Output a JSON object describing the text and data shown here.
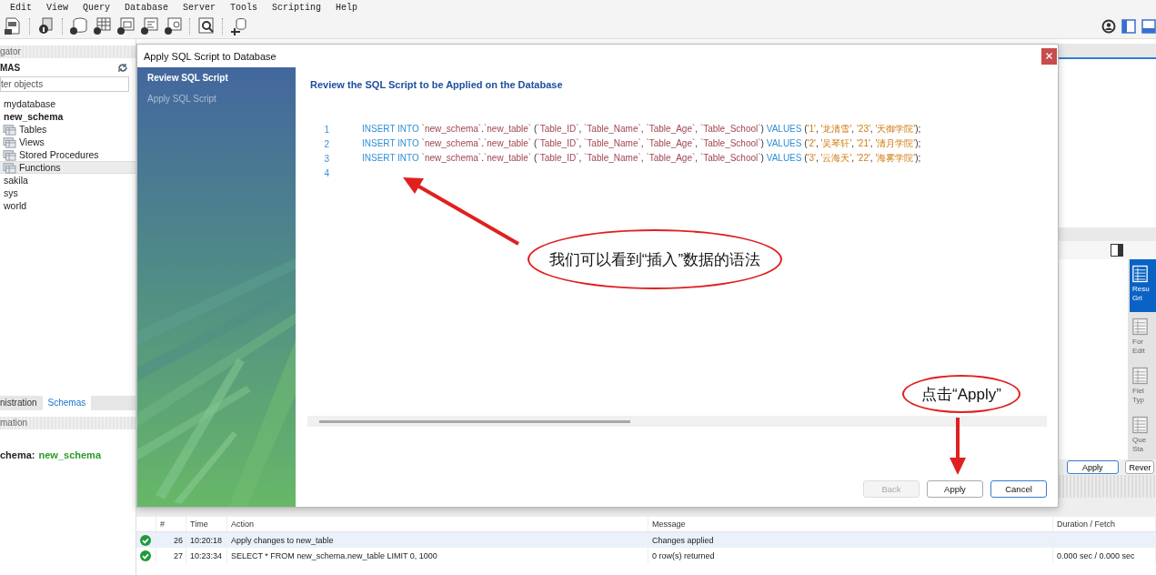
{
  "menu": [
    {
      "label": "Edit"
    },
    {
      "label": "View"
    },
    {
      "label": "Query"
    },
    {
      "label": "Database"
    },
    {
      "label": "Server"
    },
    {
      "label": "Tools"
    },
    {
      "label": "Scripting"
    },
    {
      "label": "Help"
    }
  ],
  "navigator": {
    "header": "gator",
    "section": "MAS",
    "filter_placeholder": "ter objects",
    "schemas": [
      {
        "name": "mydatabase",
        "default": false,
        "selected": false
      },
      {
        "name": "new_schema",
        "default": true,
        "selected": false,
        "children": [
          {
            "name": "Tables",
            "selected": false
          },
          {
            "name": "Views",
            "selected": false
          },
          {
            "name": "Stored Procedures",
            "selected": false
          },
          {
            "name": "Functions",
            "selected": true
          }
        ]
      },
      {
        "name": "sakila",
        "default": false,
        "selected": false
      },
      {
        "name": "sys",
        "default": false,
        "selected": false
      },
      {
        "name": "world",
        "default": false,
        "selected": false
      }
    ]
  },
  "navigator_tabs": [
    {
      "label": "nistration",
      "selected": false
    },
    {
      "label": "Schemas",
      "selected": true
    }
  ],
  "information": {
    "header": "mation",
    "label": "chema:",
    "value": "new_schema"
  },
  "side_tabs": [
    {
      "lines": [
        "Resu",
        "Gri"
      ],
      "selected": true
    },
    {
      "lines": [
        "For",
        "Edit"
      ],
      "selected": false
    },
    {
      "lines": [
        "Fiel",
        "Typ"
      ],
      "selected": false
    },
    {
      "lines": [
        "Que",
        "Sta"
      ],
      "selected": false
    }
  ],
  "panel_buttons": [
    {
      "label": "Apply",
      "default": true
    },
    {
      "label": "Rever",
      "default": false
    }
  ],
  "output": {
    "columns": [
      "#",
      "Time",
      "Action",
      "Message",
      "Duration / Fetch"
    ],
    "rows": [
      {
        "error": false,
        "selected": true,
        "number": "26",
        "time": "10:20:18",
        "action": "Apply changes to new_table",
        "message": "Changes applied"
      },
      {
        "error": false,
        "selected": false,
        "number": "27",
        "time": "10:23:34",
        "action": "SELECT * FROM new_schema.new_table LIMIT 0, 1000",
        "message": "0 row(s) returned",
        "duration": "0.000 sec / 0.000 sec"
      }
    ]
  },
  "dialog": {
    "title": "Apply SQL Script to Database",
    "steps": [
      {
        "label": "Review SQL Script",
        "selected": true
      },
      {
        "label": "Apply SQL Script",
        "selected": false
      }
    ],
    "heading": "Review the SQL Script to be Applied on the Database",
    "script": [
      {
        "number": "1",
        "tokens": [
          {
            "kind": "keyword",
            "text": "INSERT INTO "
          },
          {
            "kind": "identifier",
            "text": "`new_schema`"
          },
          {
            "kind": "plain",
            "text": "."
          },
          {
            "kind": "identifier",
            "text": "`new_table`"
          },
          {
            "kind": "plain",
            "text": " ("
          },
          {
            "kind": "identifier",
            "text": "`Table_ID`"
          },
          {
            "kind": "plain",
            "text": ", "
          },
          {
            "kind": "identifier",
            "text": "`Table_Name`"
          },
          {
            "kind": "plain",
            "text": ", "
          },
          {
            "kind": "identifier",
            "text": "`Table_Age`"
          },
          {
            "kind": "plain",
            "text": ", "
          },
          {
            "kind": "identifier",
            "text": "`Table_School`"
          },
          {
            "kind": "plain",
            "text": ") "
          },
          {
            "kind": "keyword",
            "text": "VALUES "
          },
          {
            "kind": "plain",
            "text": "("
          },
          {
            "kind": "string",
            "text": "'1'"
          },
          {
            "kind": "plain",
            "text": ", "
          },
          {
            "kind": "string",
            "text": "'龙清雪'"
          },
          {
            "kind": "plain",
            "text": ", "
          },
          {
            "kind": "string",
            "text": "'23'"
          },
          {
            "kind": "plain",
            "text": ", "
          },
          {
            "kind": "string",
            "text": "'天御学院'"
          },
          {
            "kind": "plain",
            "text": ");"
          }
        ]
      },
      {
        "number": "2",
        "tokens": [
          {
            "kind": "keyword",
            "text": "INSERT INTO "
          },
          {
            "kind": "identifier",
            "text": "`new_schema`"
          },
          {
            "kind": "plain",
            "text": "."
          },
          {
            "kind": "identifier",
            "text": "`new_table`"
          },
          {
            "kind": "plain",
            "text": " ("
          },
          {
            "kind": "identifier",
            "text": "`Table_ID`"
          },
          {
            "kind": "plain",
            "text": ", "
          },
          {
            "kind": "identifier",
            "text": "`Table_Name`"
          },
          {
            "kind": "plain",
            "text": ", "
          },
          {
            "kind": "identifier",
            "text": "`Table_Age`"
          },
          {
            "kind": "plain",
            "text": ", "
          },
          {
            "kind": "identifier",
            "text": "`Table_School`"
          },
          {
            "kind": "plain",
            "text": ") "
          },
          {
            "kind": "keyword",
            "text": "VALUES "
          },
          {
            "kind": "plain",
            "text": "("
          },
          {
            "kind": "string",
            "text": "'2'"
          },
          {
            "kind": "plain",
            "text": ", "
          },
          {
            "kind": "string",
            "text": "'吴琴轩'"
          },
          {
            "kind": "plain",
            "text": ", "
          },
          {
            "kind": "string",
            "text": "'21'"
          },
          {
            "kind": "plain",
            "text": ", "
          },
          {
            "kind": "string",
            "text": "'清月学院'"
          },
          {
            "kind": "plain",
            "text": ");"
          }
        ]
      },
      {
        "number": "3",
        "tokens": [
          {
            "kind": "keyword",
            "text": "INSERT INTO "
          },
          {
            "kind": "identifier",
            "text": "`new_schema`"
          },
          {
            "kind": "plain",
            "text": "."
          },
          {
            "kind": "identifier",
            "text": "`new_table`"
          },
          {
            "kind": "plain",
            "text": " ("
          },
          {
            "kind": "identifier",
            "text": "`Table_ID`"
          },
          {
            "kind": "plain",
            "text": ", "
          },
          {
            "kind": "identifier",
            "text": "`Table_Name`"
          },
          {
            "kind": "plain",
            "text": ", "
          },
          {
            "kind": "identifier",
            "text": "`Table_Age`"
          },
          {
            "kind": "plain",
            "text": ", "
          },
          {
            "kind": "identifier",
            "text": "`Table_School`"
          },
          {
            "kind": "plain",
            "text": ") "
          },
          {
            "kind": "keyword",
            "text": "VALUES "
          },
          {
            "kind": "plain",
            "text": "("
          },
          {
            "kind": "string",
            "text": "'3'"
          },
          {
            "kind": "plain",
            "text": ", "
          },
          {
            "kind": "string",
            "text": "'云海天'"
          },
          {
            "kind": "plain",
            "text": ", "
          },
          {
            "kind": "string",
            "text": "'22'"
          },
          {
            "kind": "plain",
            "text": ", "
          },
          {
            "kind": "string",
            "text": "'海雾学院'"
          },
          {
            "kind": "plain",
            "text": ");"
          }
        ]
      },
      {
        "number": "4"
      }
    ],
    "buttons": [
      {
        "label": "Back",
        "disabled": true,
        "default": false
      },
      {
        "label": "Apply",
        "disabled": false,
        "default": false
      },
      {
        "label": "Cancel",
        "disabled": false,
        "default": true
      }
    ]
  },
  "annotations": [
    {
      "kind": "callout",
      "text": "我们可以看到“插入”数据的语法"
    },
    {
      "kind": "callout",
      "text": "点击“Apply”"
    }
  ]
}
